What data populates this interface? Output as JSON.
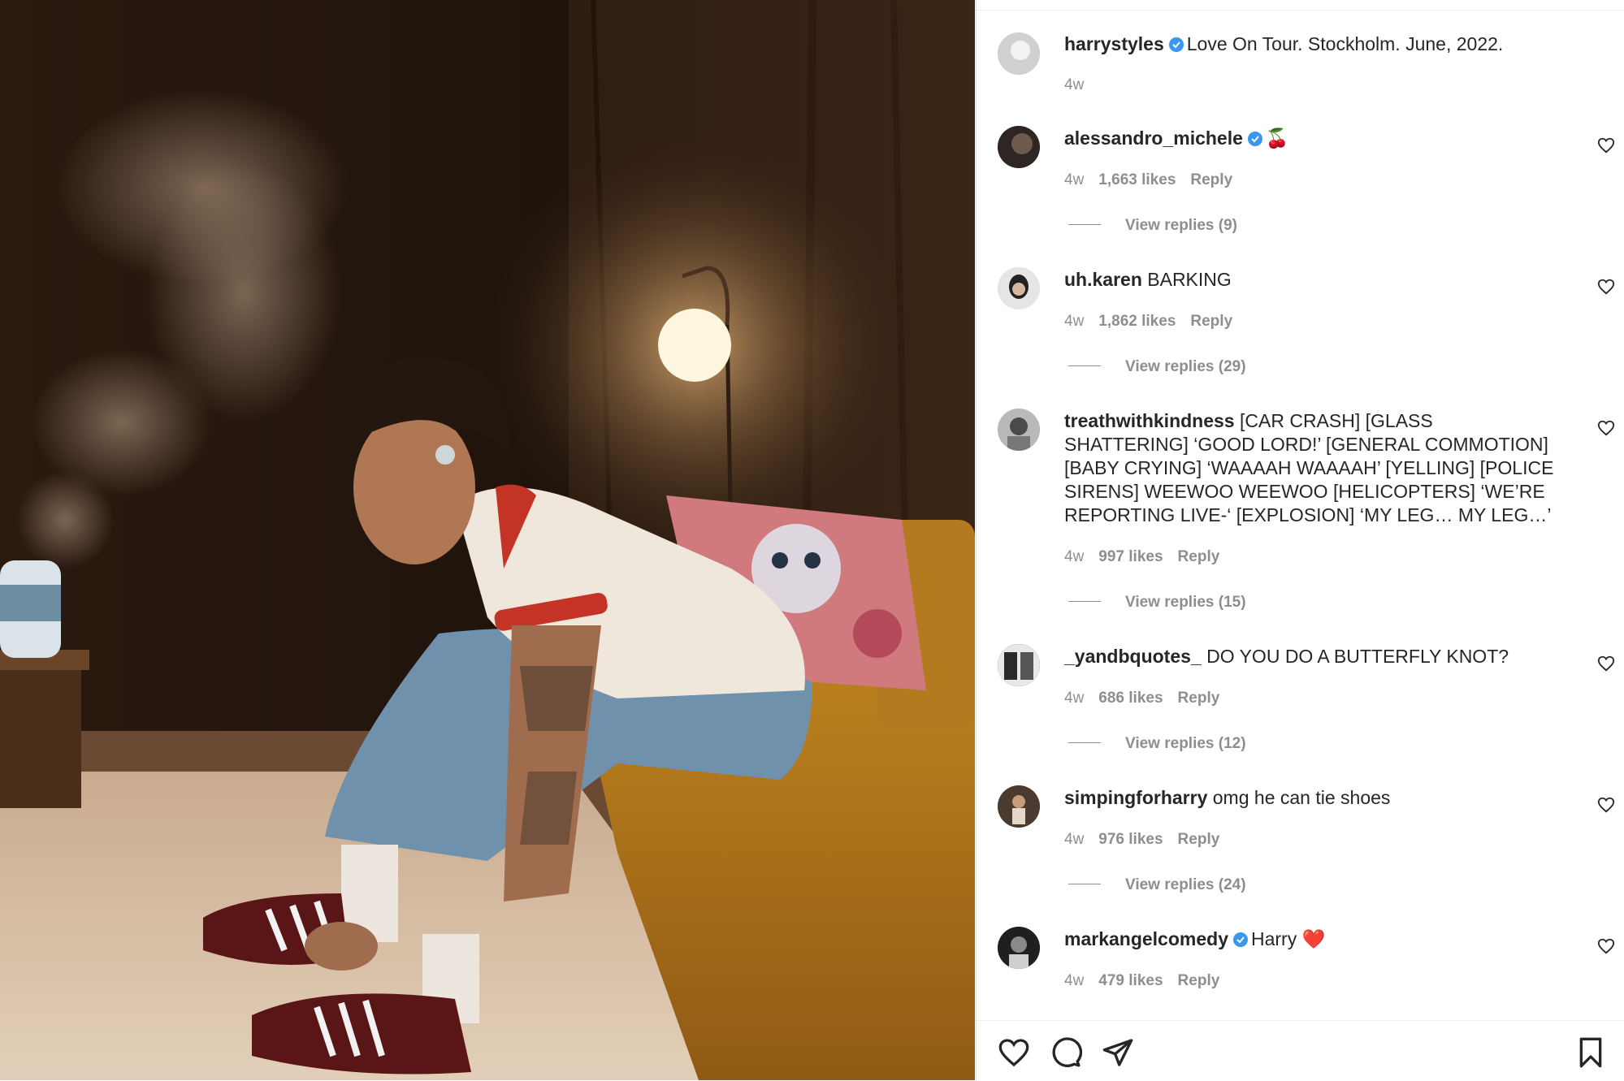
{
  "post": {
    "author": "harrystyles",
    "caption": "Love On Tour. Stockholm. June, 2022.",
    "time": "4w"
  },
  "comments": [
    {
      "user": "alessandro_michele",
      "verified": true,
      "text": "🍒",
      "time": "4w",
      "likes": "1,663 likes",
      "reply": "Reply",
      "view_replies": "View replies (9)"
    },
    {
      "user": "uh.karen",
      "verified": false,
      "text": "BARKING",
      "time": "4w",
      "likes": "1,862 likes",
      "reply": "Reply",
      "view_replies": "View replies (29)"
    },
    {
      "user": "treathwithkindness",
      "verified": false,
      "text": "[CAR CRASH] [GLASS SHATTERING] ‘GOOD LORD!’ [GENERAL COMMOTION] [BABY CRYING] ‘WAAAAH WAAAAH’ [YELLING] [POLICE SIRENS] WEEWOO WEEWOO [HELICOPTERS] ‘WE’RE REPORTING LIVE-‘ [EXPLOSION] ‘MY LEG… MY LEG…’",
      "time": "4w",
      "likes": "997 likes",
      "reply": "Reply",
      "view_replies": "View replies (15)"
    },
    {
      "user": "_yandbquotes_",
      "verified": false,
      "text": "DO YOU DO A BUTTERFLY KNOT?",
      "time": "4w",
      "likes": "686 likes",
      "reply": "Reply",
      "view_replies": "View replies (12)"
    },
    {
      "user": "simpingforharry",
      "verified": false,
      "text": "omg he can tie shoes",
      "time": "4w",
      "likes": "976 likes",
      "reply": "Reply",
      "view_replies": "View replies (24)"
    },
    {
      "user": "markangelcomedy",
      "verified": true,
      "text": "Harry ❤️",
      "time": "4w",
      "likes": "479 likes",
      "reply": "Reply",
      "view_replies": ""
    }
  ],
  "icons": {
    "like": "heart-icon",
    "comment": "comment-icon",
    "share": "share-icon",
    "save": "bookmark-icon",
    "verified": "verified-badge-icon"
  },
  "colors": {
    "verified": "#3897f0",
    "meta": "#8e8e8e",
    "text": "#262626"
  }
}
